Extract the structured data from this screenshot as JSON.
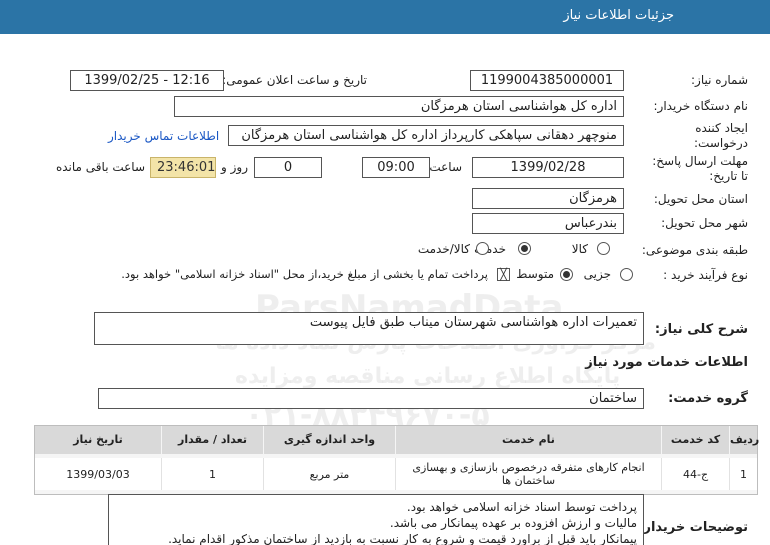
{
  "header": {
    "title": "جزئیات اطلاعات نیاز"
  },
  "form": {
    "need_number_label": "شماره نیاز:",
    "need_number": "1199004385000001",
    "announce_label": "تاریخ و ساعت اعلان عمومی:",
    "announce_value": "1399/02/25 - 12:16",
    "buyer_org_label": "نام دستگاه خریدار:",
    "buyer_org": "اداره کل هواشناسی استان هرمزگان",
    "creator_label_1": "ایجاد کننده",
    "creator_label_2": "درخواست:",
    "creator": "منوچهر دهقانی سپاهکی کارپرداز اداره کل هواشناسی استان هرمزگان",
    "buyer_contact_link": "اطلاعات تماس خریدار",
    "deadline_label_1": "مهلت ارسال پاسخ:",
    "deadline_label_2": "تا تاریخ:",
    "deadline_date": "1399/02/28",
    "time_label": "ساعت",
    "deadline_time": "09:00",
    "days_value": "0",
    "days_label": "روز و",
    "remaining_time": "23:46:01",
    "remaining_label": "ساعت باقی مانده",
    "province_label": "استان محل تحویل:",
    "province": "هرمزگان",
    "city_label": "شهر محل تحویل:",
    "city": "بندرعباس",
    "category_label": "طبقه بندی موضوعی:",
    "category_options": [
      "کالا",
      "خدمت",
      "کالا/خدمت"
    ],
    "category_selected": "خدمت",
    "process_label": "نوع فرآیند خرید :",
    "process_options": [
      "جزیی",
      "متوسط"
    ],
    "process_selected": "متوسط",
    "payment_note": "پرداخت تمام یا بخشی از مبلغ خرید،از محل \"اسناد خزانه اسلامی\" خواهد بود."
  },
  "summary": {
    "label": "شرح کلی نیاز:",
    "value": "تعمیرات اداره هواشناسی شهرستان میناب طبق فایل پیوست"
  },
  "services": {
    "section_title": "اطلاعات خدمات مورد نیاز",
    "group_label": "گروه خدمت:",
    "group_value": "ساختمان",
    "table": {
      "headers": [
        "ردیف",
        "کد خدمت",
        "نام خدمت",
        "واحد اندازه گیری",
        "تعداد / مقدار",
        "تاریخ نیاز"
      ],
      "rows": [
        [
          "1",
          "ج-44",
          "انجام کارهای متفرقه درخصوص بازسازی و بهسازی ساختمان ها",
          "متر مربع",
          "1",
          "1399/03/03"
        ]
      ]
    }
  },
  "buyer_notes": {
    "label": "توضیحات خریدار:",
    "lines": [
      "پرداخت توسط اسناد خزانه اسلامی خواهد بود.",
      "مالیات و ارزش افزوده بر عهده پیمانکار می باشد.",
      "پیمانکار باید قبل از براورد قیمت و شروع به کار نسبت به بازدید از ساختمان مذکور اقدام نماید."
    ]
  },
  "watermark": {
    "line1": "ParsNamadData",
    "line2": "مرکز فراوری اطلاعات پارس نماد داده ها",
    "line3": "پایگاه اطلاع رسانی مناقصه ومزایده",
    "line4": "۰۲۱-۸۸۳۴۹۶۷۰-۵"
  }
}
